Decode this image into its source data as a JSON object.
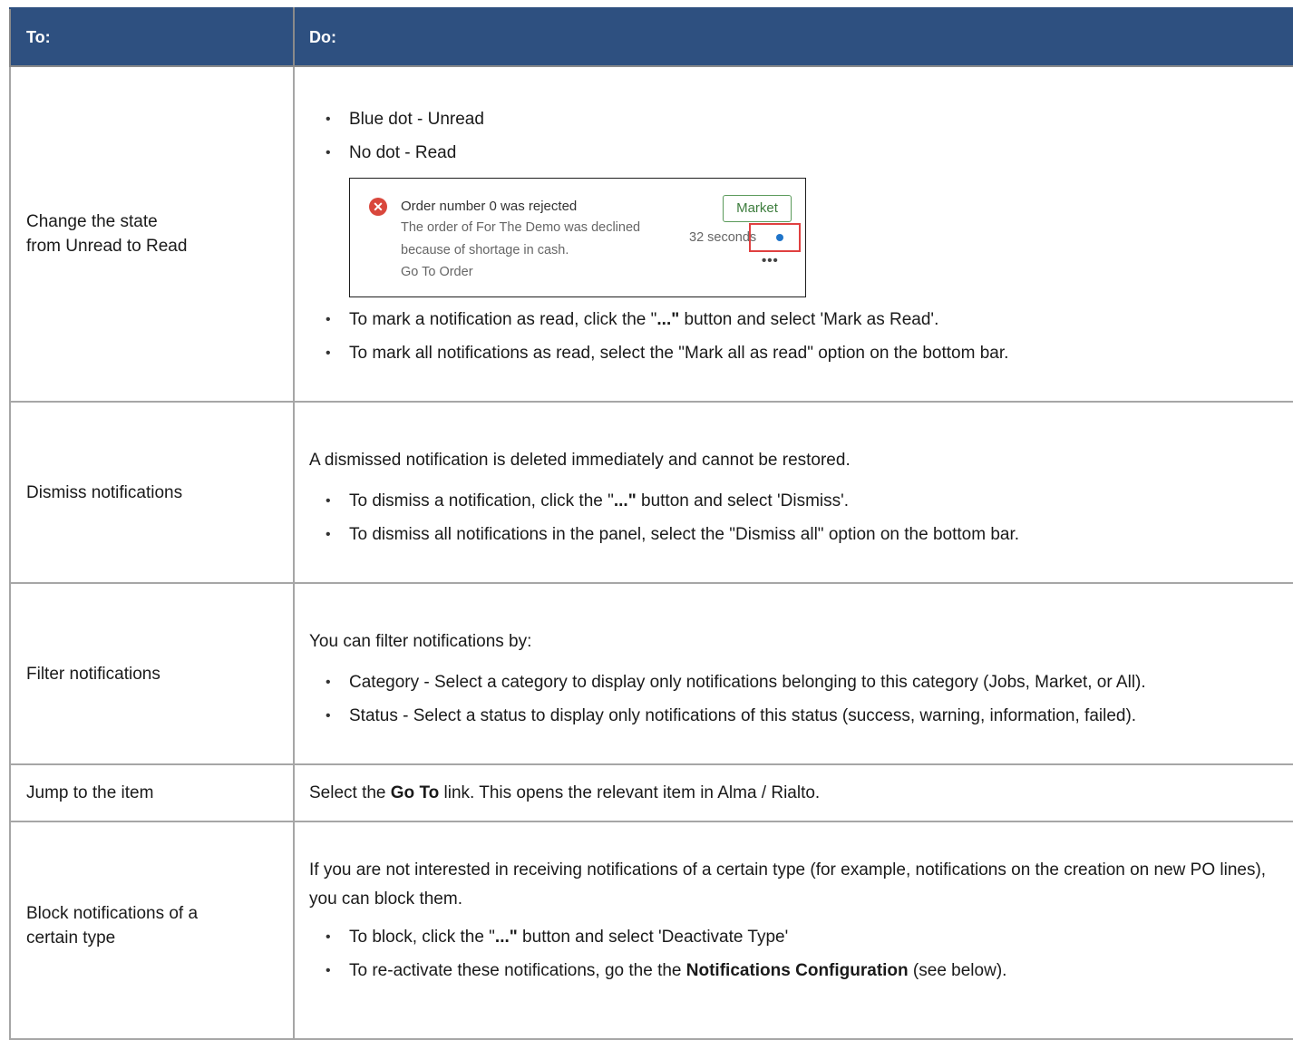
{
  "header": {
    "col_to": "To:",
    "col_do": "Do:"
  },
  "rows": [
    {
      "to": [
        "Change the state",
        "from Unread to Read"
      ],
      "bullets_top": [
        "Blue dot - Unread",
        "No dot - Read"
      ],
      "card": {
        "title": "Order number 0 was rejected",
        "line2": "The order of For The Demo was declined",
        "line3": "because of shortage in cash.",
        "link": "Go To Order",
        "category": "Market",
        "time": "32 seconds",
        "more": "•••",
        "icon": "error-x-icon"
      },
      "bullets_bottom": [
        {
          "pre": "To mark a notification as read, click the \"",
          "bold": "...\"",
          "post": " button and select 'Mark as Read'."
        },
        {
          "text": "To mark all notifications as read, select the \"Mark all as read\" option on the bottom bar."
        }
      ]
    },
    {
      "to": "Dismiss notifications",
      "intro": "A dismissed notification is deleted immediately and cannot be restored.",
      "bullets": [
        {
          "pre": "To dismiss a notification, click the \"",
          "bold": "...\"",
          "post": " button and select 'Dismiss'."
        },
        {
          "text": "To dismiss all notifications in the panel, select the \"Dismiss all\" option on the bottom bar."
        }
      ]
    },
    {
      "to": "Filter notifications",
      "intro": "You can filter notifications by:",
      "bullets": [
        {
          "text": "Category - Select a category to display only notifications belonging to this category (Jobs, Market, or All)."
        },
        {
          "text": "Status - Select a status to display only notifications of this status (success, warning, information, failed)."
        }
      ]
    },
    {
      "to": "Jump to the item",
      "pre": "Select the ",
      "bold": "Go To",
      "post": " link. This opens the relevant item in Alma / Rialto."
    },
    {
      "to": [
        "Block notifications of a",
        "certain type"
      ],
      "intro": "If you are not interested in receiving notifications of a certain type (for example, notifications on the creation on new PO lines), you can block them.",
      "bullets": [
        {
          "pre": "To block, click the \"",
          "bold": "...\"",
          "post": " button and select 'Deactivate Type'"
        },
        {
          "pre": "To re-activate these notifications, go the the ",
          "bold": "Notifications Configuration",
          "post": " (see below)."
        }
      ]
    }
  ],
  "colors": {
    "header_bg": "#2e5080",
    "unread_dot": "#1f74c9",
    "error": "#d9473c",
    "highlight": "#e04040",
    "market_tag": "#3d7d3d"
  }
}
